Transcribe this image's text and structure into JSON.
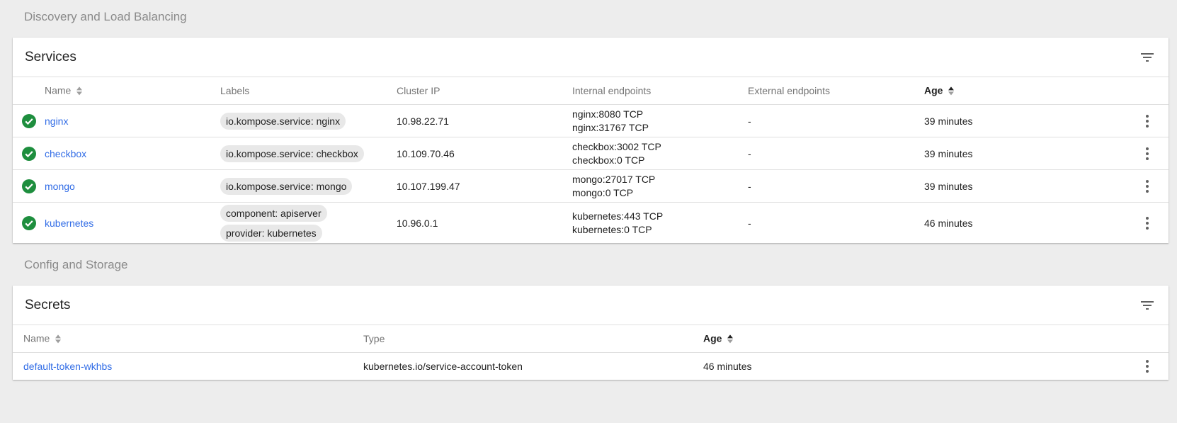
{
  "sections": {
    "discovery_title": "Discovery and Load Balancing",
    "config_title": "Config and Storage"
  },
  "services": {
    "title": "Services",
    "columns": {
      "name": "Name",
      "labels": "Labels",
      "cluster_ip": "Cluster IP",
      "internal_endpoints": "Internal endpoints",
      "external_endpoints": "External endpoints",
      "age": "Age"
    },
    "rows": [
      {
        "status": "running",
        "name": "nginx",
        "labels": [
          "io.kompose.service: nginx"
        ],
        "cluster_ip": "10.98.22.71",
        "internal_endpoints": [
          "nginx:8080 TCP",
          "nginx:31767 TCP"
        ],
        "external_endpoints": "-",
        "age": "39 minutes"
      },
      {
        "status": "running",
        "name": "checkbox",
        "labels": [
          "io.kompose.service: checkbox"
        ],
        "cluster_ip": "10.109.70.46",
        "internal_endpoints": [
          "checkbox:3002 TCP",
          "checkbox:0 TCP"
        ],
        "external_endpoints": "-",
        "age": "39 minutes"
      },
      {
        "status": "running",
        "name": "mongo",
        "labels": [
          "io.kompose.service: mongo"
        ],
        "cluster_ip": "10.107.199.47",
        "internal_endpoints": [
          "mongo:27017 TCP",
          "mongo:0 TCP"
        ],
        "external_endpoints": "-",
        "age": "39 minutes"
      },
      {
        "status": "running",
        "name": "kubernetes",
        "labels": [
          "component: apiserver",
          "provider: kubernetes"
        ],
        "cluster_ip": "10.96.0.1",
        "internal_endpoints": [
          "kubernetes:443 TCP",
          "kubernetes:0 TCP"
        ],
        "external_endpoints": "-",
        "age": "46 minutes"
      }
    ]
  },
  "secrets": {
    "title": "Secrets",
    "columns": {
      "name": "Name",
      "type": "Type",
      "age": "Age"
    },
    "rows": [
      {
        "name": "default-token-wkhbs",
        "type": "kubernetes.io/service-account-token",
        "age": "46 minutes"
      }
    ]
  },
  "icons": {
    "status": "check-circle-icon",
    "filter": "filter-list-icon",
    "menu": "more-vert-icon",
    "sort": "sort-icon"
  },
  "colors": {
    "status_ok": "#1e8e3e",
    "link": "#326de6",
    "background": "#ededed"
  }
}
